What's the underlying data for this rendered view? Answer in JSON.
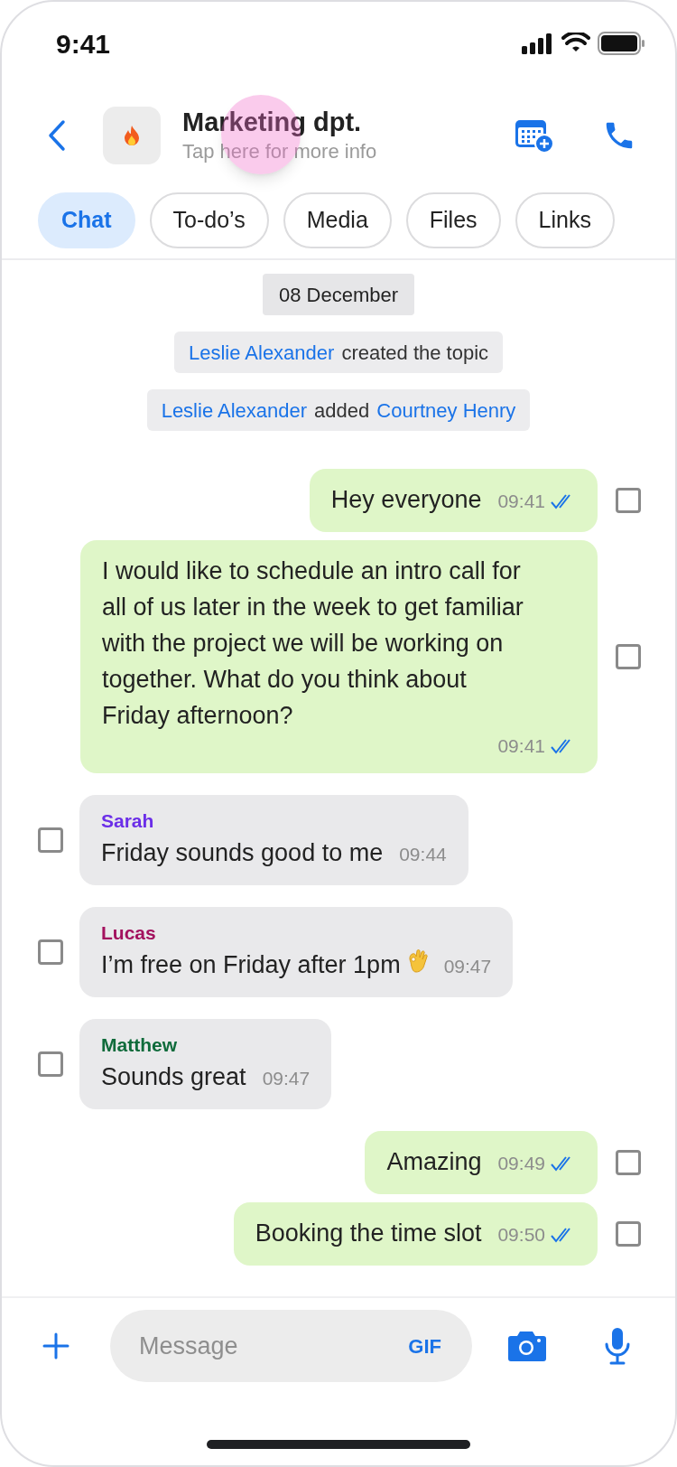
{
  "status_bar": {
    "time": "9:41"
  },
  "header": {
    "title": "Marketing dpt.",
    "subtitle": "Tap here for more info",
    "touch_indicator": true
  },
  "tabs": [
    {
      "label": "Chat",
      "selected": true
    },
    {
      "label": "To-do’s",
      "selected": false
    },
    {
      "label": "Media",
      "selected": false
    },
    {
      "label": "Files",
      "selected": false
    },
    {
      "label": "Links",
      "selected": false
    }
  ],
  "events": [
    {
      "kind": "date",
      "parts": [
        {
          "kind": "plain",
          "text": "08 December"
        }
      ]
    },
    {
      "kind": "system",
      "parts": [
        {
          "kind": "user",
          "text": "Leslie Alexander"
        },
        {
          "kind": "plain",
          "text": "created the topic"
        }
      ]
    },
    {
      "kind": "system",
      "parts": [
        {
          "kind": "user",
          "text": "Leslie Alexander"
        },
        {
          "kind": "plain",
          "text": "added"
        },
        {
          "kind": "user",
          "text": "Courtney Henry"
        }
      ]
    }
  ],
  "messages": [
    {
      "outgoing": true,
      "kind": "short",
      "text": "Hey everyone",
      "time": "09:41",
      "read": true,
      "checked": false
    },
    {
      "outgoing": true,
      "kind": "paragraph",
      "text": "I would like to schedule an intro call for all of us later in the week to get familiar with the project we will be working on together. What do you think about Friday afternoon?",
      "time": "09:41",
      "read": true,
      "checked": false
    },
    {
      "outgoing": false,
      "kind": "short",
      "sender": "Sarah",
      "color": "#6b2ee8",
      "text": "Friday sounds good to me",
      "time": "09:44",
      "checked": false
    },
    {
      "outgoing": false,
      "kind": "short",
      "sender": "Lucas",
      "color": "#a3115e",
      "text": "I’m free on Friday after 1pm",
      "has_emoji": true,
      "time": "09:47",
      "checked": false
    },
    {
      "outgoing": false,
      "kind": "short",
      "sender": "Matthew",
      "color": "#0f6b3b",
      "text": "Sounds great",
      "time": "09:47",
      "checked": false
    },
    {
      "outgoing": true,
      "kind": "short",
      "text": "Amazing",
      "time": "09:49",
      "read": true,
      "checked": false
    },
    {
      "outgoing": true,
      "kind": "short",
      "text": "Booking the time slot",
      "time": "09:50",
      "read": true,
      "checked": false
    }
  ],
  "composer": {
    "placeholder": "Message",
    "gif_label": "GIF"
  }
}
